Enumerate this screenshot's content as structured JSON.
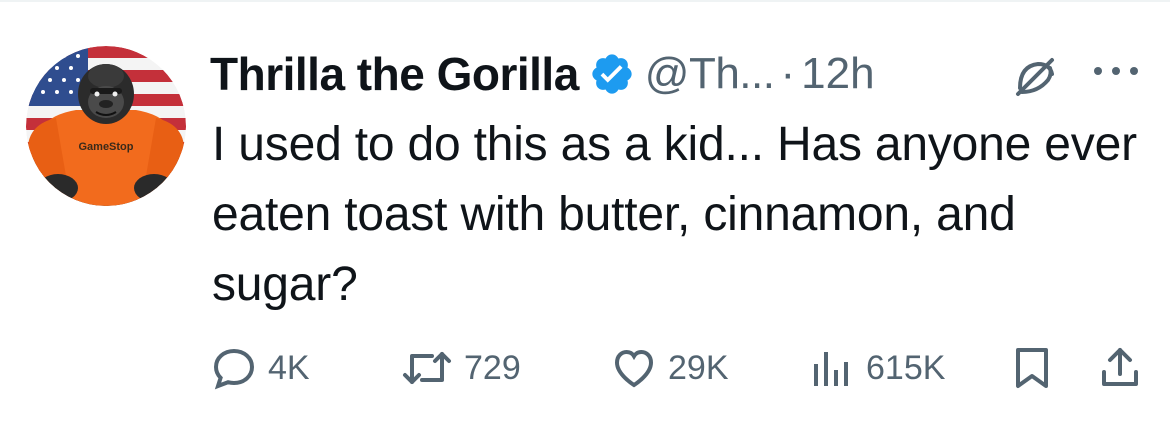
{
  "tweet": {
    "author": {
      "display_name": "Thrilla the Gorilla",
      "handle": "@Th...",
      "verified": true,
      "avatar": "gorilla-avatar",
      "avatar_shirt_text": "GameStop"
    },
    "separator": "·",
    "time": "12h",
    "text": "I used to do this as a kid... Has anyone ever eaten toast with butter, cinnamon, and sugar?",
    "actions": {
      "replies": "4K",
      "reposts": "729",
      "likes": "29K",
      "views": "615K"
    }
  },
  "icons": {
    "verified": "verified-badge-icon",
    "grok": "grok-icon",
    "more": "more-icon",
    "reply": "reply-icon",
    "repost": "repost-icon",
    "like": "like-icon",
    "views": "views-icon",
    "bookmark": "bookmark-icon",
    "share": "share-icon"
  },
  "colors": {
    "text_primary": "#0f1419",
    "text_secondary": "#536471",
    "verified_blue": "#1d9bf0",
    "shirt_orange": "#f26b1d"
  }
}
